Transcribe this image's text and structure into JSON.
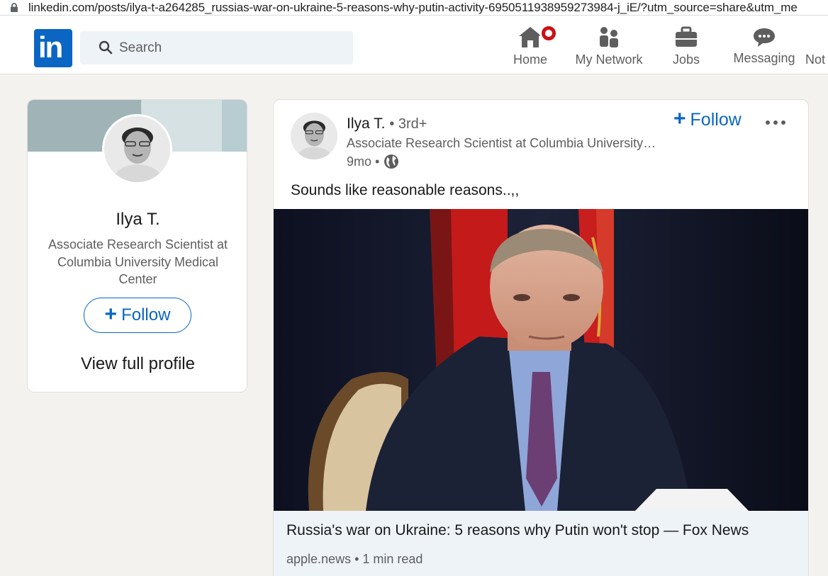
{
  "browser": {
    "url": "linkedin.com/posts/ilya-t-a264285_russias-war-on-ukraine-5-reasons-why-putin-activity-6950511938959273984-j_iE/?utm_source=share&utm_me"
  },
  "nav": {
    "logo_text": "in",
    "search_placeholder": "Search",
    "items": [
      {
        "label": "Home",
        "icon": "home-icon"
      },
      {
        "label": "My Network",
        "icon": "network-icon"
      },
      {
        "label": "Jobs",
        "icon": "briefcase-icon"
      },
      {
        "label": "Messaging",
        "icon": "messaging-icon"
      },
      {
        "label": "Not",
        "icon": "bell-icon"
      }
    ],
    "accent": "#0a66c2",
    "badge_color": "#cc1016"
  },
  "profile_card": {
    "name": "Ilya T.",
    "headline": "Associate Research Scientist at Columbia University Medical Center",
    "follow_label": "Follow",
    "view_full_profile": "View full profile"
  },
  "post": {
    "author": "Ilya T.",
    "degree": "• 3rd+",
    "headline": "Associate Research Scientist at Columbia University…",
    "time": "9mo •",
    "visibility_icon": "globe-icon",
    "follow_label": "Follow",
    "text": "Sounds like reasonable reasons..,,",
    "link": {
      "title": "Russia's war on Ukraine: 5 reasons why Putin won't stop — Fox News",
      "source": "apple.news • 1 min read"
    }
  }
}
